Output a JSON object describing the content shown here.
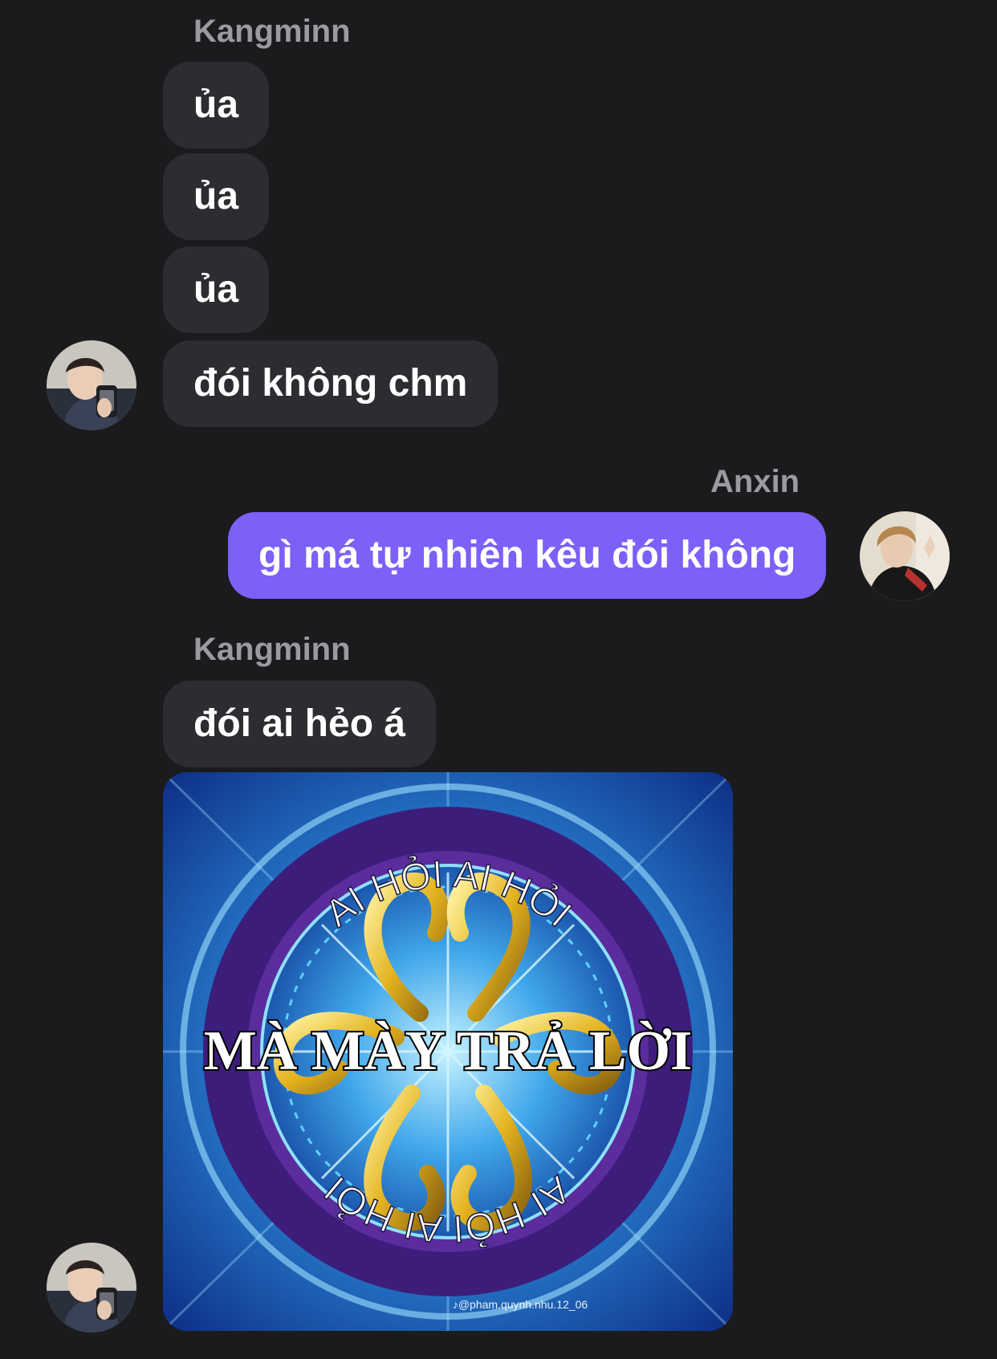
{
  "messages": [
    {
      "sender": "Kangminn"
    },
    {
      "text": "ủa"
    },
    {
      "text": "ủa"
    },
    {
      "text": "ủa"
    },
    {
      "text": "đói không chm"
    },
    {
      "sender": "Anxin"
    },
    {
      "text": "gì má tự nhiên kêu đói không"
    },
    {
      "sender": "Kangminn"
    },
    {
      "text": "đói ai hẻo á"
    }
  ],
  "meme": {
    "arc_top": "AI HỎI AI HỎI",
    "center": "MÀ MÀY TRẢ LỜI",
    "arc_bottom": "AI HỎI AI HỎI",
    "watermark": "♪@pham.quynh.nhu.12_06"
  },
  "colors": {
    "background": "#1b1b1d",
    "incoming_bubble": "#2d2d31",
    "outgoing_bubble": "#7c60f8",
    "sender_name": "#9b9b9f"
  }
}
